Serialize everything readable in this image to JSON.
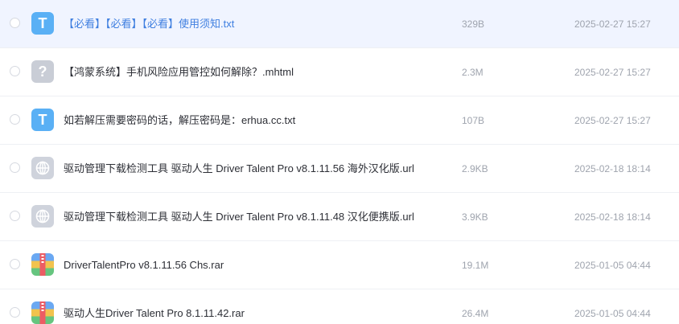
{
  "files": [
    {
      "name": "【必看】【必看】【必看】使用须知.txt",
      "size": "329B",
      "date": "2025-02-27 15:27",
      "type_icon": "txt-file-icon",
      "icon_glyph": "T",
      "selected": true
    },
    {
      "name": "【鸿蒙系统】手机风险应用管控如何解除？.mhtml",
      "size": "2.3M",
      "date": "2025-02-27 15:27",
      "type_icon": "unknown-file-icon",
      "icon_glyph": "?"
    },
    {
      "name": "如若解压需要密码的话，解压密码是：erhua.cc.txt",
      "size": "107B",
      "date": "2025-02-27 15:27",
      "type_icon": "txt-file-icon",
      "icon_glyph": "T"
    },
    {
      "name": "驱动管理下载检测工具 驱动人生 Driver Talent Pro v8.1.11.56 海外汉化版.url",
      "size": "2.9KB",
      "date": "2025-02-18 18:14",
      "type_icon": "web-link-icon"
    },
    {
      "name": "驱动管理下载检测工具 驱动人生 Driver Talent Pro v8.1.11.48 汉化便携版.url",
      "size": "3.9KB",
      "date": "2025-02-18 18:14",
      "type_icon": "web-link-icon"
    },
    {
      "name": "DriverTalentPro v8.1.11.56 Chs.rar",
      "size": "19.1M",
      "date": "2025-01-05 04:44",
      "type_icon": "archive-file-icon"
    },
    {
      "name": "驱动人生Driver Talent Pro 8.1.11.42.rar",
      "size": "26.4M",
      "date": "2025-01-05 04:44",
      "type_icon": "archive-file-icon"
    }
  ],
  "colors": {
    "selected_row_bg": "#f0f4ff",
    "selected_name": "#3f7fe0",
    "txt_icon": "#5ab0f5",
    "meta_text": "#9fa4ae"
  }
}
